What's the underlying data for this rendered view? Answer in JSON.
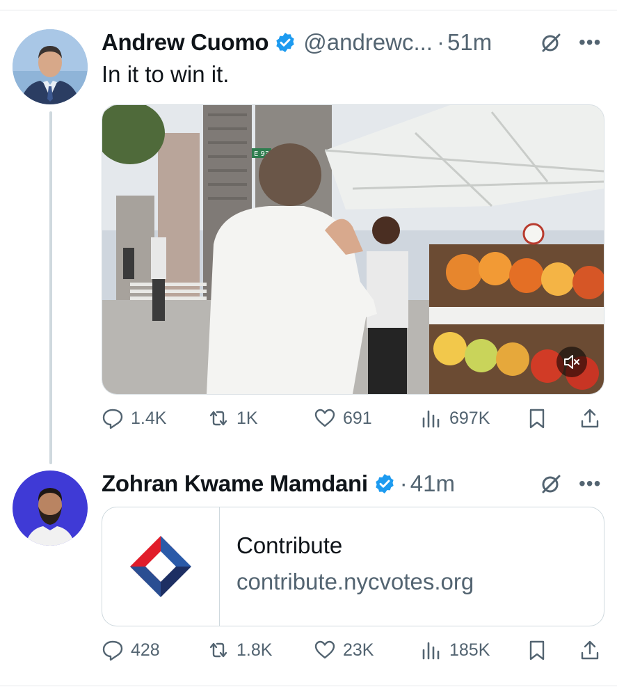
{
  "tweet1": {
    "name": "Andrew Cuomo",
    "handle": "@andrewc...",
    "separator": "·",
    "time": "51m",
    "text": "In it to win it.",
    "avatar_icon": "avatar-photo",
    "media": {
      "type": "video",
      "muted": true,
      "street_sign": "E 93"
    },
    "stats": {
      "replies": "1.4K",
      "reposts": "1K",
      "likes": "691",
      "views": "697K"
    }
  },
  "tweet2": {
    "name": "Zohran Kwame Mamdani",
    "separator": "·",
    "time": "41m",
    "avatar_icon": "avatar-photo",
    "card": {
      "title": "Contribute",
      "domain": "contribute.nycvotes.org"
    },
    "stats": {
      "replies": "428",
      "reposts": "1.8K",
      "likes": "23K",
      "views": "185K"
    }
  },
  "colors": {
    "verified": "#1d9bf0",
    "muted_text": "#536471",
    "text": "#0f1419",
    "border": "#cfd9de"
  }
}
